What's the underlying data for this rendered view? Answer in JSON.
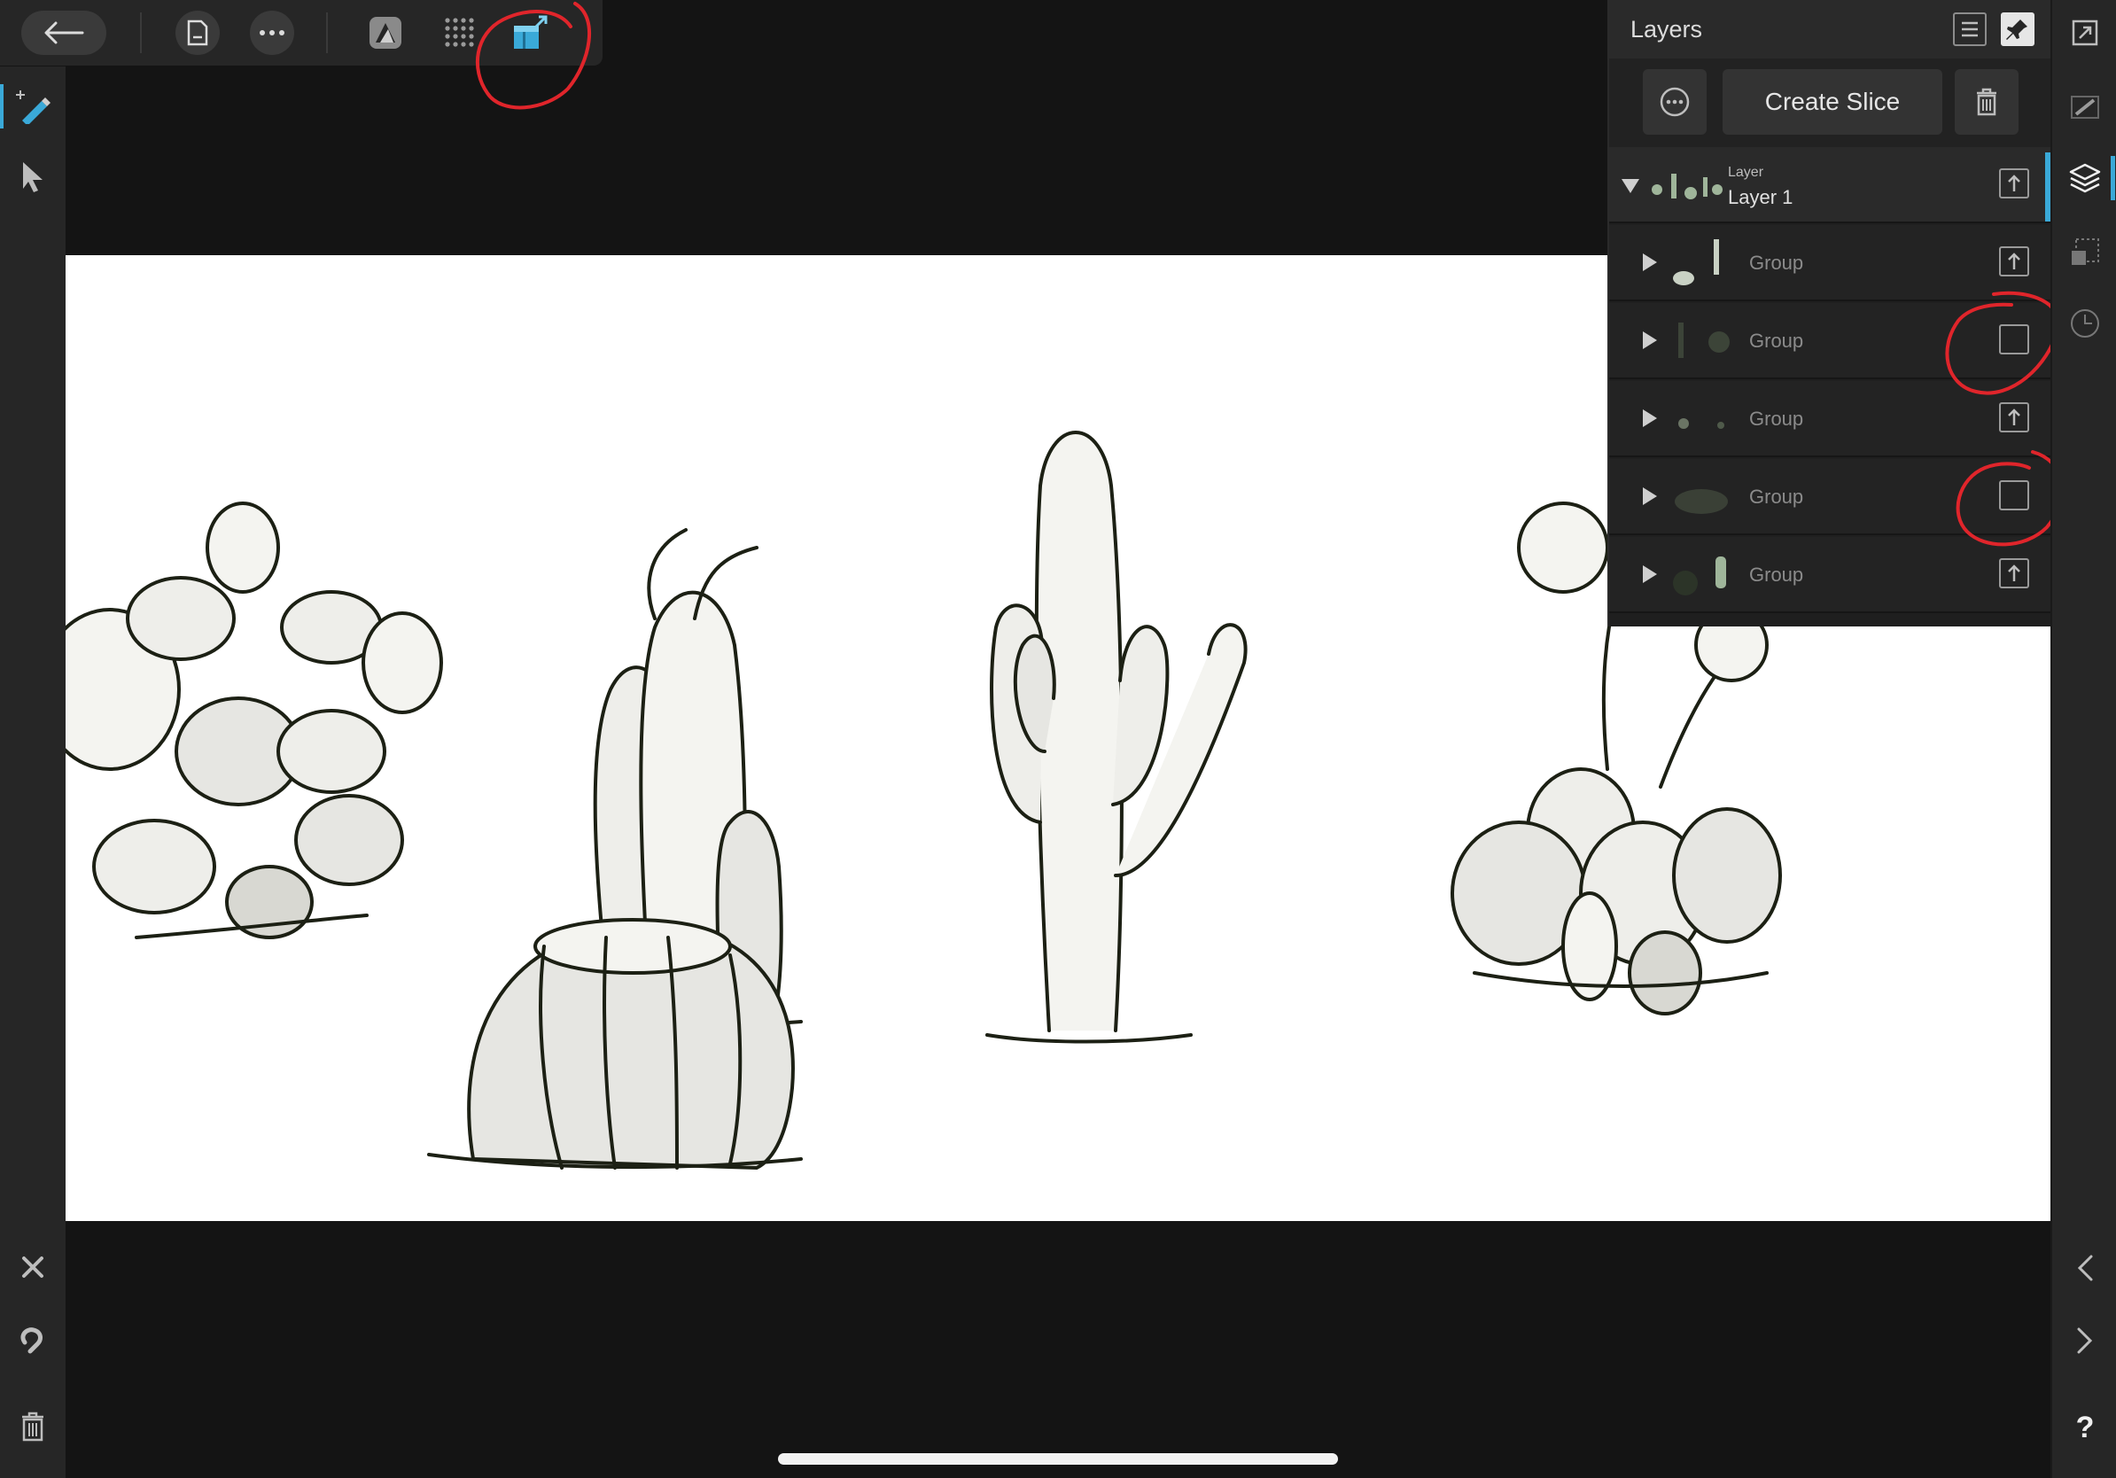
{
  "toolbar": {
    "back_icon": "arrow-left-icon",
    "document_icon": "document-icon",
    "more_icon": "more-icon",
    "persona_icon": "designer-persona-icon",
    "grid_icon": "pixel-grid-icon",
    "export_persona_icon": "export-persona-icon",
    "accent": "#3aa9d8"
  },
  "layers_panel": {
    "title": "Layers",
    "create_slice_label": "Create Slice",
    "root_layer": {
      "kind": "Layer",
      "name": "Layer 1"
    },
    "rows": [
      {
        "label": "Group",
        "checked": true
      },
      {
        "label": "Group",
        "checked": false
      },
      {
        "label": "Group",
        "checked": true
      },
      {
        "label": "Group",
        "checked": false
      },
      {
        "label": "Group",
        "checked": true
      }
    ]
  },
  "annotation_color": "#e0252b",
  "help_label": "?"
}
